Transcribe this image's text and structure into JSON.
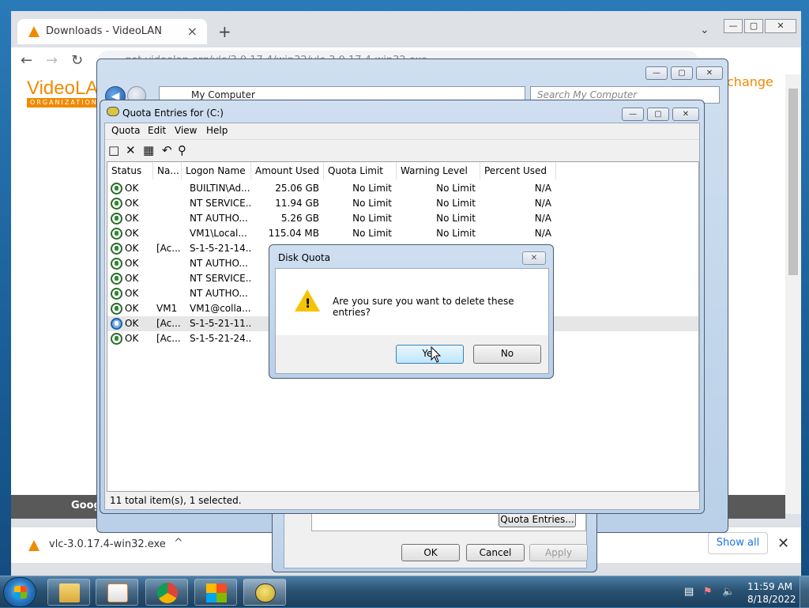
{
  "browser": {
    "tab_title": "Downloads - VideoLAN",
    "tab_close": "×",
    "new_tab": "+",
    "tab_dropdown": "⌄",
    "back": "←",
    "forward": "→",
    "reload": "↻",
    "url": "get.videolan.org/vlc/3.0.17.4/win32/vlc-3.0.17.4-win32.exe",
    "win_min": "—",
    "win_max": "▢",
    "win_close": "✕",
    "page_logo": "VideoLAN",
    "page_logo_org": "ORGANIZATION",
    "page_change": "change",
    "page_footer_text": "Goog",
    "download_file": "vlc-3.0.17.4-win32.exe",
    "download_chevron": "^",
    "show_all": "Show all",
    "download_close": "✕"
  },
  "explorer": {
    "address": "My Computer",
    "search_placeholder": "Search My Computer",
    "back_arrow": "◀"
  },
  "properties": {
    "quota_entries_button": "Quota Entries...",
    "ok": "OK",
    "cancel": "Cancel",
    "apply": "Apply"
  },
  "quota": {
    "title": "Quota Entries for  (C:)",
    "menu": [
      "Quota",
      "Edit",
      "View",
      "Help"
    ],
    "columns": [
      "Status",
      "Na...",
      "Logon Name",
      "Amount Used",
      "Quota Limit",
      "Warning Level",
      "Percent Used"
    ],
    "rows": [
      {
        "status": "OK",
        "name": "",
        "logon": "BUILTIN\\Ad...",
        "amount": "25.06 GB",
        "limit": "No Limit",
        "warning": "No Limit",
        "percent": "N/A"
      },
      {
        "status": "OK",
        "name": "",
        "logon": "NT SERVICE...",
        "amount": "11.94 GB",
        "limit": "No Limit",
        "warning": "No Limit",
        "percent": "N/A"
      },
      {
        "status": "OK",
        "name": "",
        "logon": "NT AUTHO...",
        "amount": "5.26 GB",
        "limit": "No Limit",
        "warning": "No Limit",
        "percent": "N/A"
      },
      {
        "status": "OK",
        "name": "",
        "logon": "VM1\\Local...",
        "amount": "115.04 MB",
        "limit": "No Limit",
        "warning": "No Limit",
        "percent": "N/A"
      },
      {
        "status": "OK",
        "name": "[Ac...",
        "logon": "S-1-5-21-14...",
        "amount": "",
        "limit": "",
        "warning": "",
        "percent": ""
      },
      {
        "status": "OK",
        "name": "",
        "logon": "NT AUTHO...",
        "amount": "",
        "limit": "",
        "warning": "",
        "percent": ""
      },
      {
        "status": "OK",
        "name": "",
        "logon": "NT SERVICE...",
        "amount": "",
        "limit": "",
        "warning": "",
        "percent": ""
      },
      {
        "status": "OK",
        "name": "",
        "logon": "NT AUTHO...",
        "amount": "",
        "limit": "",
        "warning": "",
        "percent": ""
      },
      {
        "status": "OK",
        "name": "VM1",
        "logon": "VM1@colla...",
        "amount": "",
        "limit": "",
        "warning": "",
        "percent": ""
      },
      {
        "status": "OK",
        "name": "[Ac...",
        "logon": "S-1-5-21-11...",
        "amount": "",
        "limit": "",
        "warning": "",
        "percent": "",
        "selected": true
      },
      {
        "status": "OK",
        "name": "[Ac...",
        "logon": "S-1-5-21-24...",
        "amount": "",
        "limit": "",
        "warning": "",
        "percent": ""
      }
    ],
    "status_bar": "11 total item(s), 1 selected."
  },
  "dialog": {
    "title": "Disk Quota",
    "close": "✕",
    "message": "Are you sure you want to delete these entries?",
    "warn_mark": "!",
    "yes": "Yes",
    "no": "No"
  },
  "taskbar": {
    "time": "11:59 AM",
    "date": "8/18/2022"
  },
  "colors": {
    "accent": "#f08a00",
    "selection": "#e6e6e6",
    "status_ok": "#2e8b2e"
  }
}
